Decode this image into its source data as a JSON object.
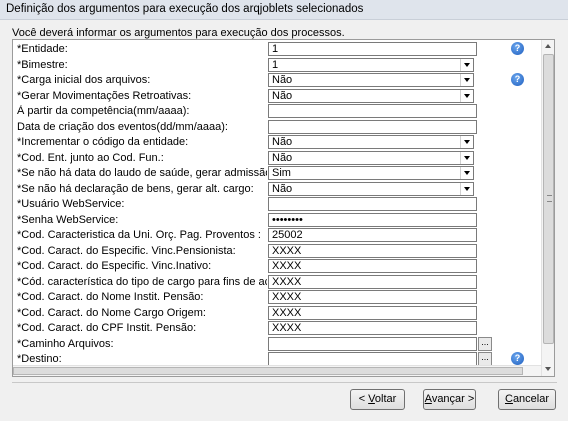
{
  "window": {
    "title": "Definição dos argumentos para execução dos arqjoblets selecionados"
  },
  "intro": "Você deverá informar os argumentos para execução dos processos.",
  "rows": [
    {
      "label": "*Entidade:",
      "type": "text",
      "value": "1",
      "help": true
    },
    {
      "label": "*Bimestre:",
      "type": "select",
      "value": "1"
    },
    {
      "label": "*Carga inicial dos arquivos:",
      "type": "select",
      "value": "Não",
      "help": true
    },
    {
      "label": "*Gerar Movimentações Retroativas:",
      "type": "select",
      "value": "Não"
    },
    {
      "label": "À partir da competência(mm/aaaa):",
      "type": "text",
      "value": ""
    },
    {
      "label": "Data de criação dos eventos(dd/mm/aaaa):",
      "type": "text",
      "value": ""
    },
    {
      "label": "*Incrementar o código da entidade:",
      "type": "select",
      "value": "Não"
    },
    {
      "label": "*Cod. Ent. junto ao Cod. Fun.:",
      "type": "select",
      "value": "Não"
    },
    {
      "label": "*Se não há data do laudo de saúde, gerar admissão:",
      "type": "select",
      "value": "Sim"
    },
    {
      "label": "*Se não há declaração de bens, gerar alt. cargo:",
      "type": "select",
      "value": "Não"
    },
    {
      "label": "*Usuário WebService:",
      "type": "text",
      "value": ""
    },
    {
      "label": "*Senha WebService:",
      "type": "text",
      "value": "••••••••"
    },
    {
      "label": "*Cod. Caracteristica da Uni. Orç. Pag. Proventos :",
      "type": "text",
      "value": "25002"
    },
    {
      "label": "*Cod. Caract. do Especific. Vinc.Pensionista:",
      "type": "text",
      "value": "XXXX"
    },
    {
      "label": "*Cod. Caract. do Especific. Vinc.Inativo:",
      "type": "text",
      "value": "XXXX"
    },
    {
      "label": "*Cód. característica do tipo de cargo para fins de acumulação:",
      "type": "text",
      "value": "XXXX"
    },
    {
      "label": "*Cod. Caract. do Nome Instit. Pensão:",
      "type": "text",
      "value": "XXXX"
    },
    {
      "label": "*Cod. Caract. do Nome Cargo Origem:",
      "type": "text",
      "value": "XXXX"
    },
    {
      "label": "*Cod. Caract. do CPF Instit. Pensão:",
      "type": "text",
      "value": "XXXX"
    },
    {
      "label": "*Caminho Arquivos:",
      "type": "path",
      "value": ""
    },
    {
      "label": "*Destino:",
      "type": "path",
      "value": "",
      "help": true
    }
  ],
  "buttons": {
    "back": {
      "accel": "V",
      "rest": "oltar",
      "prefix": "< "
    },
    "next": {
      "accel": "A",
      "rest": "vançar",
      "suffix": " >"
    },
    "cancel": {
      "accel": "C",
      "rest": "ancelar"
    }
  },
  "icons": {
    "help": "help-icon",
    "browse": "ellipsis-icon",
    "dropdown": "chevron-down-icon"
  },
  "colors": {
    "help": "#1f5fbf",
    "panel_bg": "#ffffff",
    "window_bg": "#f0f0f0"
  }
}
